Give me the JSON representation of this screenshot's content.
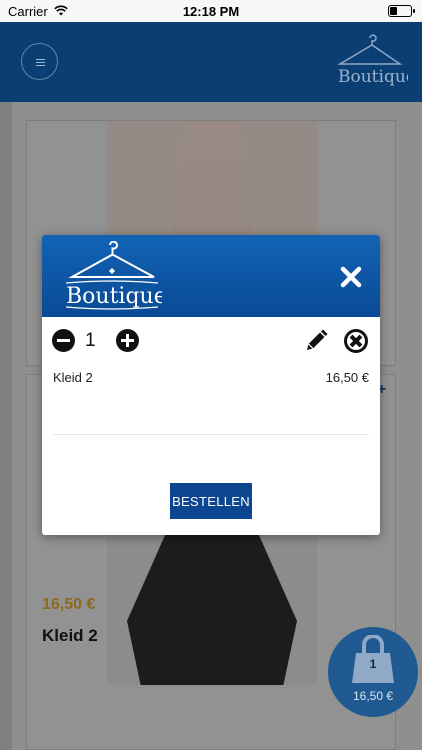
{
  "status_bar": {
    "carrier": "Carrier",
    "time": "12:18 PM"
  },
  "app": {
    "logo_text": "Boutique"
  },
  "background": {
    "product_price": "16,50 €",
    "product_name": "Kleid 2"
  },
  "cart_fab": {
    "count": "1",
    "total": "16,50 €"
  },
  "modal": {
    "logo_text": "Boutique",
    "quantity": "1",
    "item_name": "Kleid 2",
    "item_price": "16,50 €",
    "order_label": "BESTELLEN"
  },
  "icons": {
    "menu": "menu-icon",
    "close": "close-icon",
    "minus": "minus-circle-icon",
    "plus": "plus-circle-icon",
    "edit": "pencil-icon",
    "remove": "remove-circle-icon",
    "cart": "shopping-bag-icon"
  },
  "colors": {
    "brand": "#0b4a95",
    "price": "#c78a1a",
    "button": "#0d4690"
  }
}
